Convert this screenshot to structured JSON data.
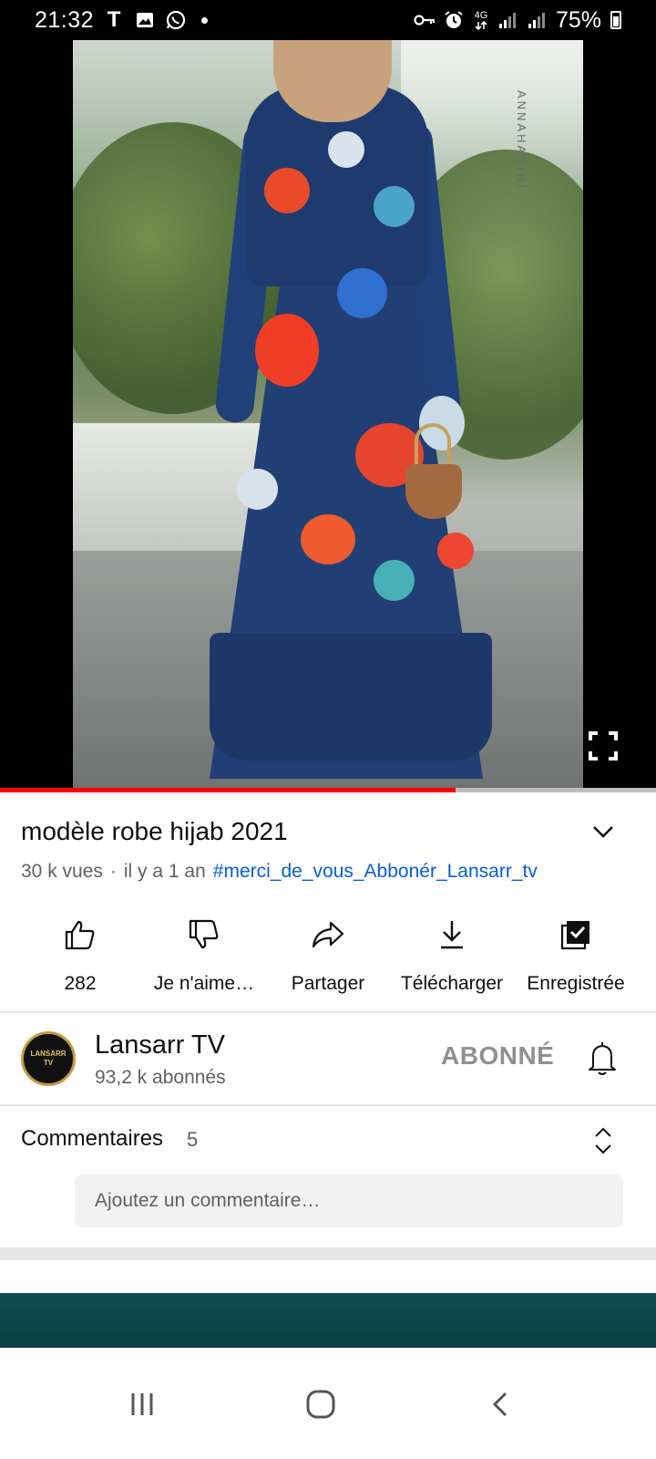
{
  "status_bar": {
    "time": "21:32",
    "carrier_letter": "T",
    "network": "4G",
    "battery_percent": "75%",
    "icons": [
      "t-icon",
      "gallery-icon",
      "whatsapp-icon",
      "dot-icon",
      "vpn-key-icon",
      "alarm-icon",
      "network-4g-icon",
      "signal-icon",
      "signal-icon-2",
      "battery-icon"
    ]
  },
  "video": {
    "watermark": "ANNAHARIRI",
    "progress": 0.695,
    "fullscreen_icon": "fullscreen-icon"
  },
  "video_info": {
    "title": "modèle robe hijab 2021",
    "views": "30 k vues",
    "separator": "·",
    "age": "il y a 1 an",
    "hashtag": "#merci_de_vous_Abbonér_Lansarr_tv"
  },
  "actions": [
    {
      "icon": "thumb-up-icon",
      "label": "282"
    },
    {
      "icon": "thumb-down-icon",
      "label": "Je n'aime…"
    },
    {
      "icon": "share-icon",
      "label": "Partager"
    },
    {
      "icon": "download-icon",
      "label": "Télécharger"
    },
    {
      "icon": "saved-playlist-icon",
      "label": "Enregistrée"
    }
  ],
  "channel": {
    "avatar_text_1": "LANSARR",
    "avatar_text_2": "TV",
    "name": "Lansarr TV",
    "subscribers": "93,2 k abonnés",
    "subscribe_label": "ABONNÉ"
  },
  "comments": {
    "label": "Commentaires",
    "count": "5",
    "placeholder": "Ajoutez un commentaire…"
  },
  "colors": {
    "progress_red": "#ff0000",
    "link_blue": "#065fd4",
    "muted_gray": "#606060"
  }
}
